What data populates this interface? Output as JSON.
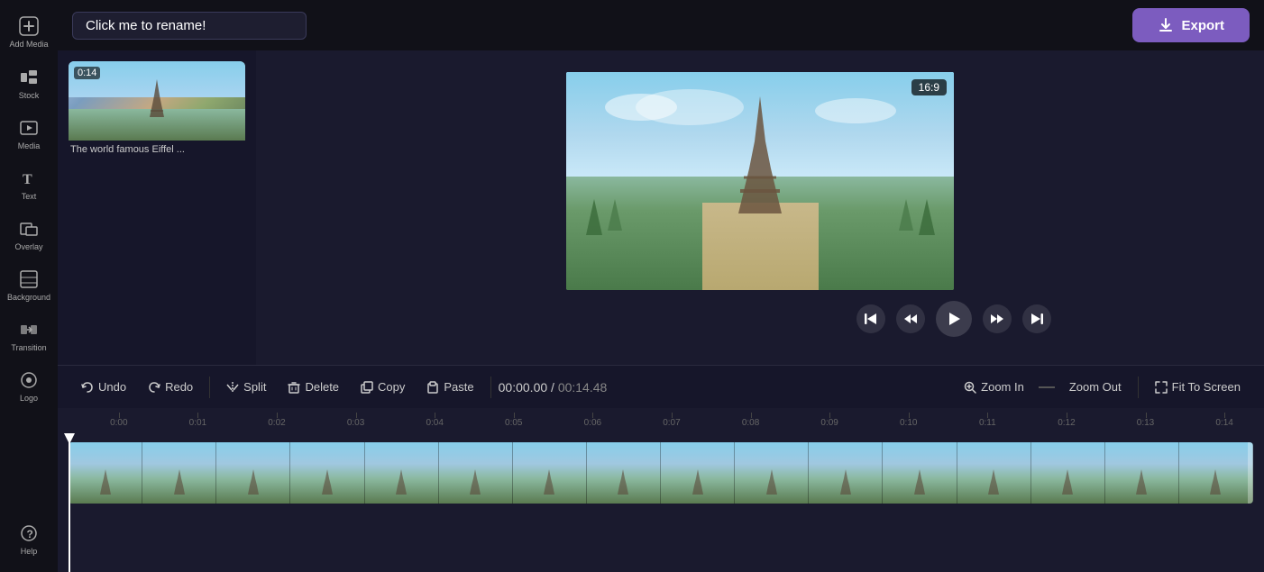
{
  "app": {
    "title": "Click me to rename!"
  },
  "topbar": {
    "export_label": "Export"
  },
  "sidebar": {
    "items": [
      {
        "id": "add-media",
        "label": "Add Media",
        "icon": "+"
      },
      {
        "id": "stock",
        "label": "Stock",
        "icon": "▦"
      },
      {
        "id": "media",
        "label": "Media",
        "icon": "🎞"
      },
      {
        "id": "text",
        "label": "Text",
        "icon": "T"
      },
      {
        "id": "overlay",
        "label": "Overlay",
        "icon": "⊞"
      },
      {
        "id": "background",
        "label": "Background",
        "icon": "▤"
      },
      {
        "id": "transition",
        "label": "Transition",
        "icon": "↔"
      },
      {
        "id": "logo",
        "label": "Logo",
        "icon": "◎"
      },
      {
        "id": "help",
        "label": "Help",
        "icon": "?"
      }
    ]
  },
  "media_panel": {
    "items": [
      {
        "duration": "0:14",
        "label": "The world famous Eiffel ..."
      }
    ]
  },
  "preview": {
    "aspect_ratio": "16:9"
  },
  "playback": {
    "skip_back_label": "⏮",
    "rewind_label": "⏪",
    "play_label": "▶",
    "forward_label": "⏩",
    "skip_forward_label": "⏭"
  },
  "toolbar": {
    "undo_label": "Undo",
    "redo_label": "Redo",
    "split_label": "Split",
    "delete_label": "Delete",
    "copy_label": "Copy",
    "paste_label": "Paste",
    "time_current": "00:00.00",
    "time_total": "00:14.48",
    "zoom_in_label": "Zoom In",
    "zoom_out_label": "Zoom Out",
    "fit_to_screen_label": "Fit To Screen"
  },
  "timeline": {
    "ruler_marks": [
      "0:00",
      "0:01",
      "0:02",
      "0:03",
      "0:04",
      "0:05",
      "0:06",
      "0:07",
      "0:08",
      "0:09",
      "0:10",
      "0:11",
      "0:12",
      "0:13",
      "0:14"
    ]
  },
  "colors": {
    "accent": "#7c5cbf",
    "toolbar_bg": "#16162a",
    "sidebar_bg": "#111118",
    "preview_bg": "#1a1a2e",
    "timeline_bg": "#1a1a2e",
    "track_bg": "#2a6060"
  }
}
